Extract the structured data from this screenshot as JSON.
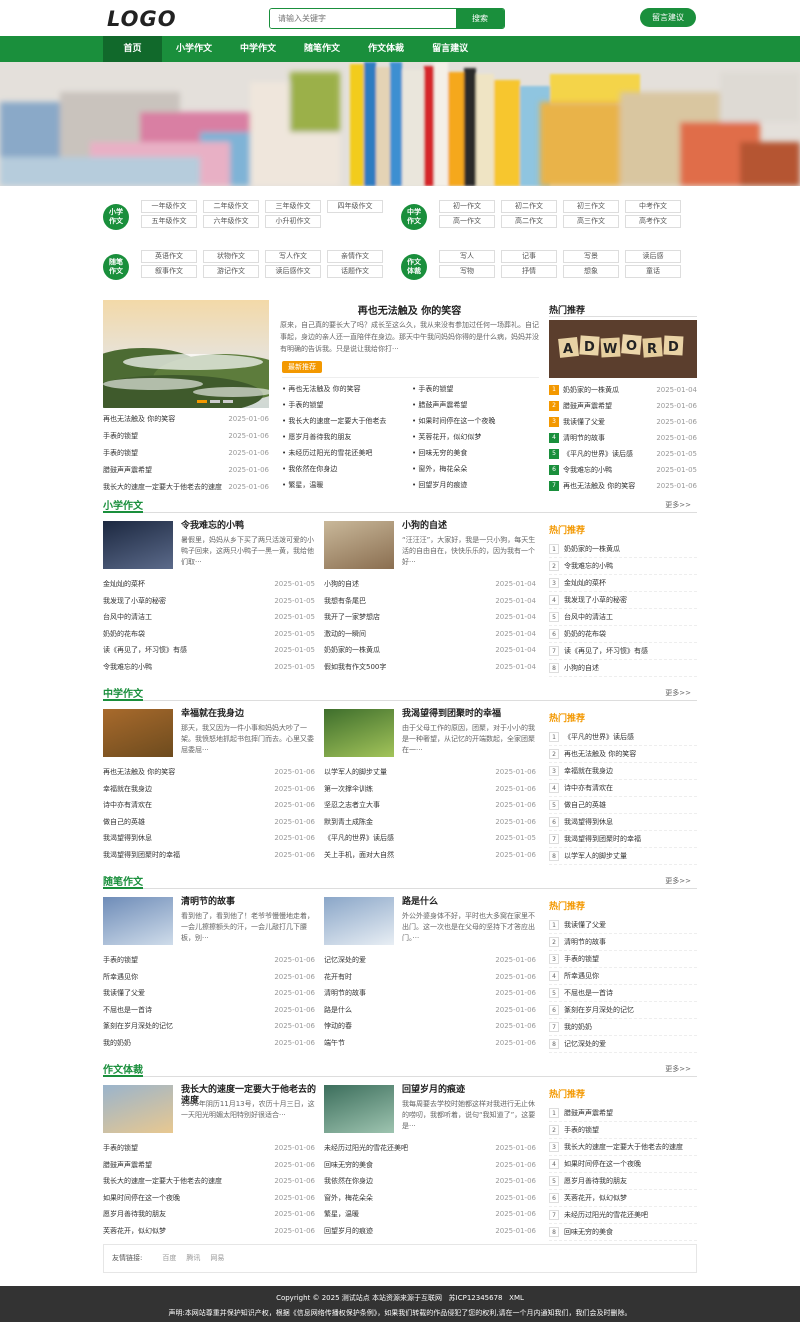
{
  "header": {
    "logo": "LOGO",
    "search_placeholder": "请输入关键字",
    "search_button": "搜索",
    "msg_button": "留言建议"
  },
  "nav": [
    "首页",
    "小学作文",
    "中学作文",
    "随笔作文",
    "作文体裁",
    "留言建议"
  ],
  "category_groups": [
    {
      "badge": "小学\n作文",
      "tags": [
        "一年级作文",
        "二年级作文",
        "三年级作文",
        "四年级作文",
        "五年级作文",
        "六年级作文",
        "小升初作文"
      ]
    },
    {
      "badge": "中学\n作文",
      "tags": [
        "初一作文",
        "初二作文",
        "初三作文",
        "中考作文",
        "高一作文",
        "高二作文",
        "高三作文",
        "高考作文"
      ]
    },
    {
      "badge": "随笔\n作文",
      "tags": [
        "英语作文",
        "状物作文",
        "写人作文",
        "亲情作文",
        "叙事作文",
        "游记作文",
        "读后感作文",
        "话题作文"
      ]
    },
    {
      "badge": "作文\n体裁",
      "tags": [
        "写人",
        "记事",
        "写景",
        "读后感",
        "写物",
        "抒情",
        "想象",
        "童话"
      ]
    }
  ],
  "top": {
    "headline": "再也无法触及 你的笑容",
    "headline_desc": "原来，自己真的要长大了吗？成长至这么久，我从来没有参加过任何一场葬礼。自记事起，身边的亲人还一直陪伴在身边。那天中午我问妈妈你得的是什么病，妈妈并没有明确的告诉我。只是说让我给你打···",
    "latest_btn": "最新推荐",
    "slider_list": [
      {
        "t": "再也无法触及 你的笑容",
        "d": "2025-01-06"
      },
      {
        "t": "手表的锁望",
        "d": "2025-01-06"
      },
      {
        "t": "手表的锁望",
        "d": "2025-01-06"
      },
      {
        "t": "腊鼓声声震希望",
        "d": "2025-01-06"
      },
      {
        "t": "我长大的速度一定要大于他老去的速度",
        "d": "2025-01-06"
      }
    ],
    "mid_left": [
      "再也无法触及 你的笑容",
      "手表的锁望",
      "我长大的速度一定要大于他老去",
      "愿岁月善待我的朋友",
      "未经历过阳光的雪花还美吧",
      "我依然在你身边",
      "繁星，温暖"
    ],
    "mid_right": [
      "手表的锁望",
      "腊鼓声声震希望",
      "如果时间停在这一个夜晚",
      "芙蓉花开，似幻似梦",
      "回味无穷的美食",
      "窗外，梅花朵朵",
      "回望岁月的痕迹"
    ],
    "hot_title": "热门推荐",
    "hot": [
      {
        "t": "奶奶家的一株黄瓜",
        "d": "2025-01-04"
      },
      {
        "t": "腊鼓声声震希望",
        "d": "2025-01-06"
      },
      {
        "t": "我读懂了父爱",
        "d": "2025-01-06"
      },
      {
        "t": "清明节的故事",
        "d": "2025-01-06"
      },
      {
        "t": "《平凡的世界》读后感",
        "d": "2025-01-05"
      },
      {
        "t": "令我难忘的小鸭",
        "d": "2025-01-05"
      },
      {
        "t": "再也无法触及 你的笑容",
        "d": "2025-01-06"
      }
    ]
  },
  "sections": [
    {
      "title": "小学作文",
      "more": "更多>>",
      "feat": [
        {
          "t": "令我难忘的小鸭",
          "d": "暑假里，妈妈从乡下买了两只活泼可爱的小鸭子回来，这两只小鸭子一黑一黄，我给他们取···"
        },
        {
          "t": "小狗的自述",
          "d": "“汪汪汪”，大家好，我是一只小狗，每天生活的自由自在，快快乐乐的，因为我有一个好···"
        }
      ],
      "left": [
        [
          "金灿灿的菜杯",
          "2025-01-05"
        ],
        [
          "我发现了小草的秘密",
          "2025-01-05"
        ],
        [
          "台风中的清洁工",
          "2025-01-05"
        ],
        [
          "奶奶的花布袋",
          "2025-01-05"
        ],
        [
          "读《再见了，坏习惯》有感",
          "2025-01-05"
        ],
        [
          "令我难忘的小鸭",
          "2025-01-05"
        ]
      ],
      "right": [
        [
          "小狗的自述",
          "2025-01-04"
        ],
        [
          "我想有条尾巴",
          "2025-01-04"
        ],
        [
          "我开了一家梦想店",
          "2025-01-04"
        ],
        [
          "激动的一瞬间",
          "2025-01-04"
        ],
        [
          "奶奶家的一株黄瓜",
          "2025-01-04"
        ],
        [
          "假如我有作文500字",
          "2025-01-04"
        ]
      ],
      "hot_title": "热门推荐",
      "hot": [
        "奶奶家的一株黄瓜",
        "令我难忘的小鸭",
        "金灿灿的菜杯",
        "我发现了小草的秘密",
        "台风中的清洁工",
        "奶奶的花布袋",
        "读《再见了，坏习惯》有感",
        "小狗的自述"
      ]
    },
    {
      "title": "中学作文",
      "more": "更多>>",
      "feat": [
        {
          "t": "幸福就在我身边",
          "d": "那天，我又因为一件小事和妈妈大吵了一架。我愤怒地抓起书包摔门而去。心里又委屈委屈···"
        },
        {
          "t": "我渴望得到团聚时的幸福",
          "d": "由于父母工作的原因，团聚，对于小小的我是一种奢望，从记忆的开端数起，全家团聚在一···"
        }
      ],
      "left": [
        [
          "再也无法触及 你的笑容",
          "2025-01-06"
        ],
        [
          "幸福就在我身边",
          "2025-01-06"
        ],
        [
          "诗中亦有清欢在",
          "2025-01-06"
        ],
        [
          "做自己的英雄",
          "2025-01-06"
        ],
        [
          "我渴望得到休息",
          "2025-01-06"
        ],
        [
          "我渴望得到团聚时的幸福",
          "2025-01-06"
        ]
      ],
      "right": [
        [
          "以学军人的脚步丈量",
          "2025-01-06"
        ],
        [
          "第一次撑伞训练",
          "2025-01-06"
        ],
        [
          "坚忍之志者立大事",
          "2025-01-06"
        ],
        [
          "默到青土成陈金",
          "2025-01-06"
        ],
        [
          "《平凡的世界》读后感",
          "2025-01-05"
        ],
        [
          "关上手机，面对大自然",
          "2025-01-06"
        ]
      ],
      "hot_title": "热门推荐",
      "hot": [
        "《平凡的世界》读后感",
        "再也无法触及 你的笑容",
        "幸福就在我身边",
        "诗中亦有清欢在",
        "做自己的英雄",
        "我渴望得到休息",
        "我渴望得到团聚时的幸福",
        "以学军人的脚步丈量"
      ]
    },
    {
      "title": "随笔作文",
      "more": "更多>>",
      "feat": [
        {
          "t": "清明节的故事",
          "d": "看到他了，看到他了！老爷爷慢慢地走着，一会儿擦擦额头的汗，一会儿敲打几下腰板，别···"
        },
        {
          "t": "路是什么",
          "d": "外公外婆身体不好，平时也大多窝在家里不出门。这一次也是在父母的坚持下才答应出门。···"
        }
      ],
      "left": [
        [
          "手表的锁望",
          "2025-01-06"
        ],
        [
          "所幸遇见你",
          "2025-01-06"
        ],
        [
          "我读懂了父爱",
          "2025-01-06"
        ],
        [
          "不屈也是一首诗",
          "2025-01-06"
        ],
        [
          "篆刻在岁月深处的记忆",
          "2025-01-06"
        ],
        [
          "我的奶奶",
          "2025-01-06"
        ]
      ],
      "right": [
        [
          "记忆深处的爱",
          "2025-01-06"
        ],
        [
          "花开有时",
          "2025-01-06"
        ],
        [
          "清明节的故事",
          "2025-01-06"
        ],
        [
          "路是什么",
          "2025-01-06"
        ],
        [
          "悖动的春",
          "2025-01-06"
        ],
        [
          "端午节",
          "2025-01-06"
        ]
      ],
      "hot_title": "热门推荐",
      "hot": [
        "我读懂了父爱",
        "清明节的故事",
        "手表的锁望",
        "所幸遇见你",
        "不屈也是一首诗",
        "篆刻在岁月深处的记忆",
        "我的奶奶",
        "记忆深处的爱"
      ]
    },
    {
      "title": "作文体裁",
      "more": "更多>>",
      "feat": [
        {
          "t": "我长大的速度一定要大于他老去的速度",
          "d": "1996年阴历11月13号，农历十月三日，这一天阳光明媚太阳特别好很适合···"
        },
        {
          "t": "回望岁月的痕迹",
          "d": "我每周要去学校时她都这样对我进行无止休的唠叨，我都听着，说句“我知道了”，这要是···"
        }
      ],
      "left": [
        [
          "手表的锁望",
          "2025-01-06"
        ],
        [
          "腊鼓声声震希望",
          "2025-01-06"
        ],
        [
          "我长大的速度一定要大于他老去的速度",
          "2025-01-06"
        ],
        [
          "如果时间停在这一个夜晚",
          "2025-01-06"
        ],
        [
          "愿岁月善待我的朋友",
          "2025-01-06"
        ],
        [
          "芙蓉花开，似幻似梦",
          "2025-01-06"
        ]
      ],
      "right": [
        [
          "未经历过阳光的雪花还美吧",
          "2025-01-06"
        ],
        [
          "回味无穷的美食",
          "2025-01-06"
        ],
        [
          "我依然在你身边",
          "2025-01-06"
        ],
        [
          "窗外，梅花朵朵",
          "2025-01-06"
        ],
        [
          "繁星，温暖",
          "2025-01-06"
        ],
        [
          "回望岁月的痕迹",
          "2025-01-06"
        ]
      ],
      "hot_title": "热门推荐",
      "hot": [
        "腊鼓声声震希望",
        "手表的锁望",
        "我长大的速度一定要大于他老去的速度",
        "如果时间停在这一个夜晚",
        "愿岁月善待我的朋友",
        "芙蓉花开，似幻似梦",
        "未经历过阳光的雪花还美吧",
        "回味无穷的美食"
      ]
    }
  ],
  "friend_links": {
    "label": "友情链接:",
    "links": [
      "百度",
      "腾讯",
      "网易"
    ]
  },
  "footer": {
    "copyright": "Copyright © 2025 测试站点 本站资源来源于互联网",
    "icp": "苏ICP12345678",
    "xml": "XML",
    "statement": "声明:本网站尊重并保护知识产权，根据《信息网络传播权保护条例》，如果我们转载的作品侵犯了您的权利,请在一个月内通知我们，我们会及时删除。"
  },
  "colors": {
    "brand": "#1a8f3c",
    "accent": "#f39800"
  }
}
